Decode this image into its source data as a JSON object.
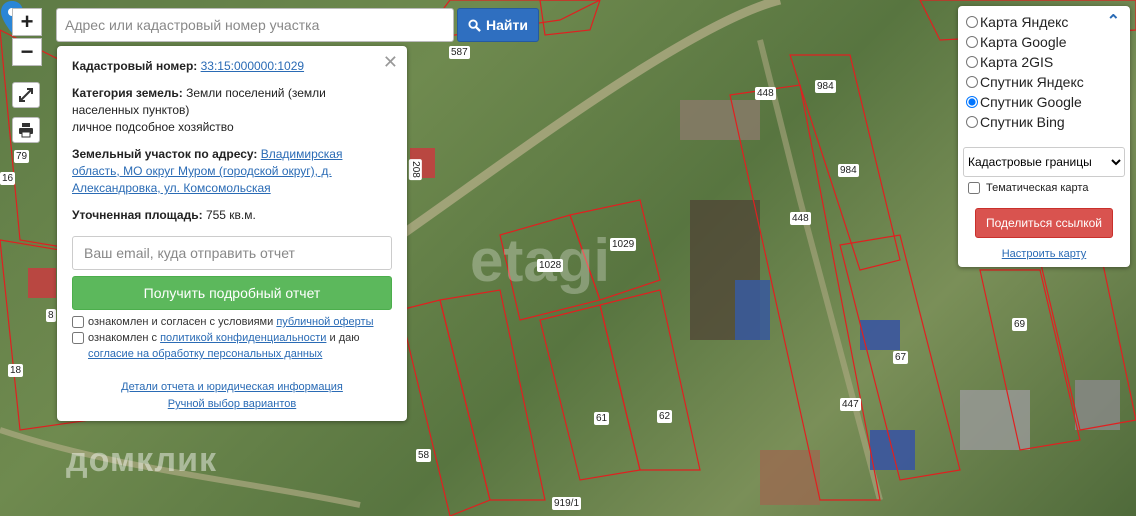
{
  "search": {
    "placeholder": "Адрес или кадастровый номер участка",
    "button_label": "Найти"
  },
  "zoom": {
    "in_label": "+",
    "out_label": "−"
  },
  "info": {
    "cadastral_label": "Кадастровый номер:",
    "cadastral_value": "33:15:000000:1029",
    "category_label": "Категория земель:",
    "category_value": "Земли поселений (земли населенных пунктов)",
    "usage": "личное подсобное хозяйство",
    "address_label": "Земельный участок по адресу:",
    "address_value": "Владимирская область, МО округ Муром (городской округ), д. Александровка, ул. Комсомольская",
    "area_label": "Уточненная площадь:",
    "area_value": "755 кв.м.",
    "email_placeholder": "Ваш email, куда отправить отчет",
    "report_button": "Получить подробный отчет",
    "agree1_text": "ознакомлен и согласен с условиями ",
    "agree1_link": "публичной оферты",
    "agree2_text": "ознакомлен с ",
    "agree2_link": "политикой конфиденциальности",
    "agree2_mid": " и даю ",
    "agree2_link2": "согласие на обработку персональных данных",
    "link_details": "Детали отчета и юридическая информация",
    "link_manual": "Ручной выбор вариантов"
  },
  "layers": {
    "options": [
      {
        "label": "Карта Яндекс",
        "checked": false
      },
      {
        "label": "Карта Google",
        "checked": false
      },
      {
        "label": "Карта 2GIS",
        "checked": false
      },
      {
        "label": "Спутник Яндекс",
        "checked": false
      },
      {
        "label": "Спутник Google",
        "checked": true
      },
      {
        "label": "Спутник Bing",
        "checked": false
      }
    ],
    "select_value": "Кадастровые границы",
    "thematic_label": "Тематическая карта",
    "share_button": "Поделиться ссылкой",
    "setup_link": "Настроить карту"
  },
  "map": {
    "labels": [
      "587",
      "448",
      "984",
      "984",
      "448",
      "1029",
      "1028",
      "208",
      "1",
      "79",
      "16",
      "8",
      "18",
      "58",
      "61",
      "62",
      "67",
      "69",
      "447",
      "919/1"
    ],
    "watermark": "домклик",
    "etagi": "etagi"
  }
}
